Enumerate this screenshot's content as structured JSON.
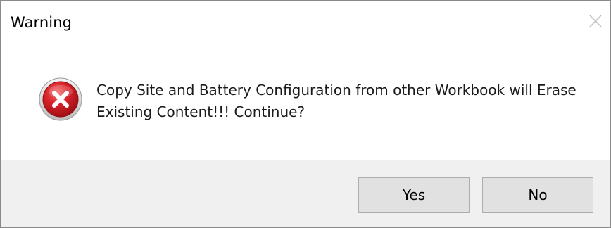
{
  "window": {
    "title": "Warning",
    "close_icon": "close-icon"
  },
  "message": {
    "icon": "error-icon",
    "line1": "Copy Site and Battery Configuration from other Workbook will Erase",
    "line2": "Existing Content!!! Continue?"
  },
  "buttons": {
    "yes_label": "Yes",
    "no_label": "No"
  },
  "colors": {
    "error_red": "#c8171e",
    "footer_bg": "#f0f0f0",
    "button_bg": "#e1e1e1",
    "button_border": "#adadad"
  }
}
